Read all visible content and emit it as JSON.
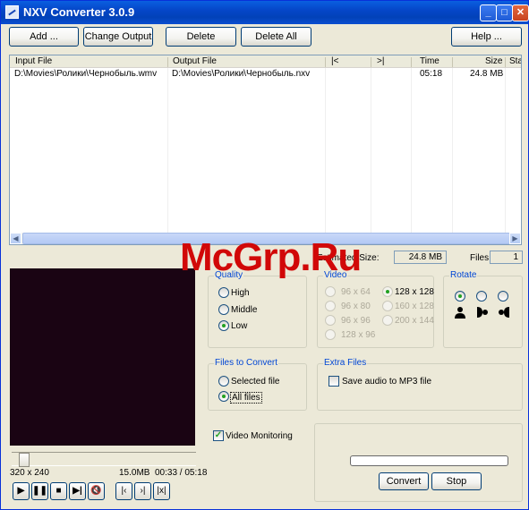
{
  "window": {
    "title": "NXV Converter 3.0.9",
    "minimize": "_",
    "maximize": "□",
    "close": "✕"
  },
  "toolbar": {
    "add": "Add ...",
    "change_output": "Change Output ...",
    "delete": "Delete",
    "delete_all": "Delete All",
    "help": "Help ..."
  },
  "list": {
    "columns": [
      "Input File",
      "Output File",
      "|<",
      ">|",
      "Time",
      "Size",
      "Sta"
    ],
    "rows": [
      {
        "input": "D:\\Movies\\Ролики\\Чернобыль.wmv",
        "output": "D:\\Movies\\Ролики\\Чернобыль.nxv",
        "start": "",
        "end": "",
        "time": "05:18",
        "size": "24.8 MB"
      }
    ]
  },
  "summary": {
    "estimated_label": "Estimated Size:",
    "estimated_value": "24.8 MB",
    "files_label": "Files:",
    "files_value": "1"
  },
  "quality": {
    "title": "Quality",
    "options": [
      "High",
      "Middle",
      "Low"
    ],
    "selected": "Low"
  },
  "video": {
    "title": "Video",
    "options": [
      "96 x 64",
      "128 x 128",
      "96 x 80",
      "160 x 128",
      "96 x 96",
      "200 x 144",
      "128 x 96"
    ],
    "selected": "128 x 128"
  },
  "rotate": {
    "title": "Rotate"
  },
  "files_to_convert": {
    "title": "Files to Convert",
    "options": [
      "Selected file",
      "All files"
    ],
    "selected": "All files"
  },
  "extra_files": {
    "title": "Extra Files",
    "save_audio": "Save audio to MP3 file",
    "save_audio_checked": false
  },
  "video_monitoring": {
    "label": "Video Monitoring",
    "checked": true
  },
  "player": {
    "resolution": "320 x 240",
    "size": "15.0MB",
    "time": "00:33 / 05:18",
    "position_fraction": 0.1
  },
  "actions": {
    "convert": "Convert",
    "stop": "Stop"
  },
  "watermark": "McGrp.Ru",
  "colors": {
    "title_bar": "#0546c8",
    "group_title": "#0046d5",
    "radio_dot": "#21a121",
    "watermark": "#d10808"
  }
}
